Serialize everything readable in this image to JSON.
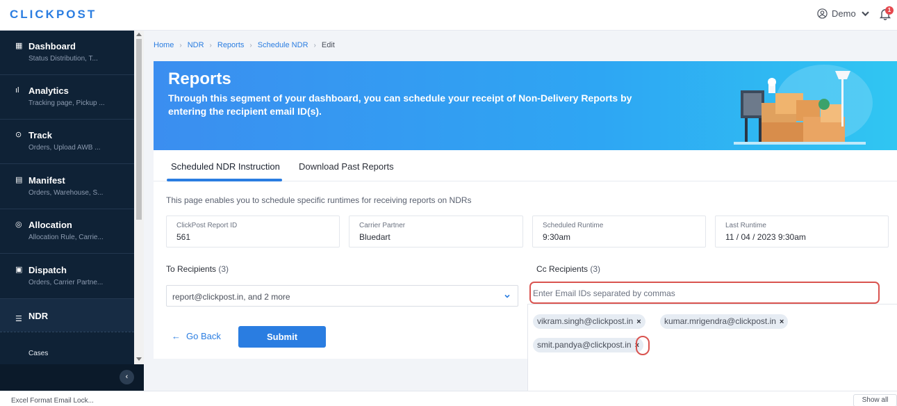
{
  "header": {
    "logo": "CLICKPOST",
    "user_name": "Demo",
    "notification_count": "1"
  },
  "sidebar": {
    "items": [
      {
        "title": "Dashboard",
        "subtitle": "Status Distribution, T...",
        "icon": "grid-icon"
      },
      {
        "title": "Analytics",
        "subtitle": "Tracking page, Pickup ...",
        "icon": "bar-chart-icon"
      },
      {
        "title": "Track",
        "subtitle": "Orders, Upload AWB ...",
        "icon": "location-pin-icon"
      },
      {
        "title": "Manifest",
        "subtitle": "Orders, Warehouse, S...",
        "icon": "document-icon"
      },
      {
        "title": "Allocation",
        "subtitle": "Allocation Rule, Carrie...",
        "icon": "target-icon"
      },
      {
        "title": "Dispatch",
        "subtitle": "Orders, Carrier Partne...",
        "icon": "clipboard-icon"
      },
      {
        "title": "NDR",
        "subtitle": "",
        "icon": "list-icon"
      }
    ],
    "sub_item": "Cases"
  },
  "breadcrumb": [
    "Home",
    "NDR",
    "Reports",
    "Schedule NDR",
    "Edit"
  ],
  "banner": {
    "title": "Reports",
    "text": "Through this segment of your dashboard, you can schedule your receipt of Non-Delivery Reports by entering the recipient email ID(s)."
  },
  "tabs": [
    "Scheduled NDR Instruction",
    "Download Past Reports"
  ],
  "description": "This page enables you to schedule specific runtimes for receiving reports on NDRs",
  "info": [
    {
      "label": "ClickPost Report ID",
      "value": "561"
    },
    {
      "label": "Carrier Partner",
      "value": "Bluedart"
    },
    {
      "label": "Scheduled Runtime",
      "value": "9:30am"
    },
    {
      "label": "Last Runtime",
      "value": "11 / 04 / 2023 9:30am"
    }
  ],
  "to_recipients": {
    "label": "To Recipients",
    "count": "(3)",
    "selected": "report@clickpost.in, and 2 more"
  },
  "cc_recipients": {
    "label": "Cc Recipients",
    "count": "(3)",
    "placeholder": "Enter Email IDs separated by commas",
    "emails": [
      "vikram.singh@clickpost.in",
      "kumar.mrigendra@clickpost.in",
      "smit.pandya@clickpost.in"
    ]
  },
  "actions": {
    "go_back": "Go Back",
    "submit": "Submit"
  },
  "footer": {
    "left": "Excel Format Email Lock...",
    "right": "Show all"
  },
  "colors": {
    "accent": "#2a7de1",
    "sidebar": "#0f2236",
    "highlight": "#d9534f"
  }
}
